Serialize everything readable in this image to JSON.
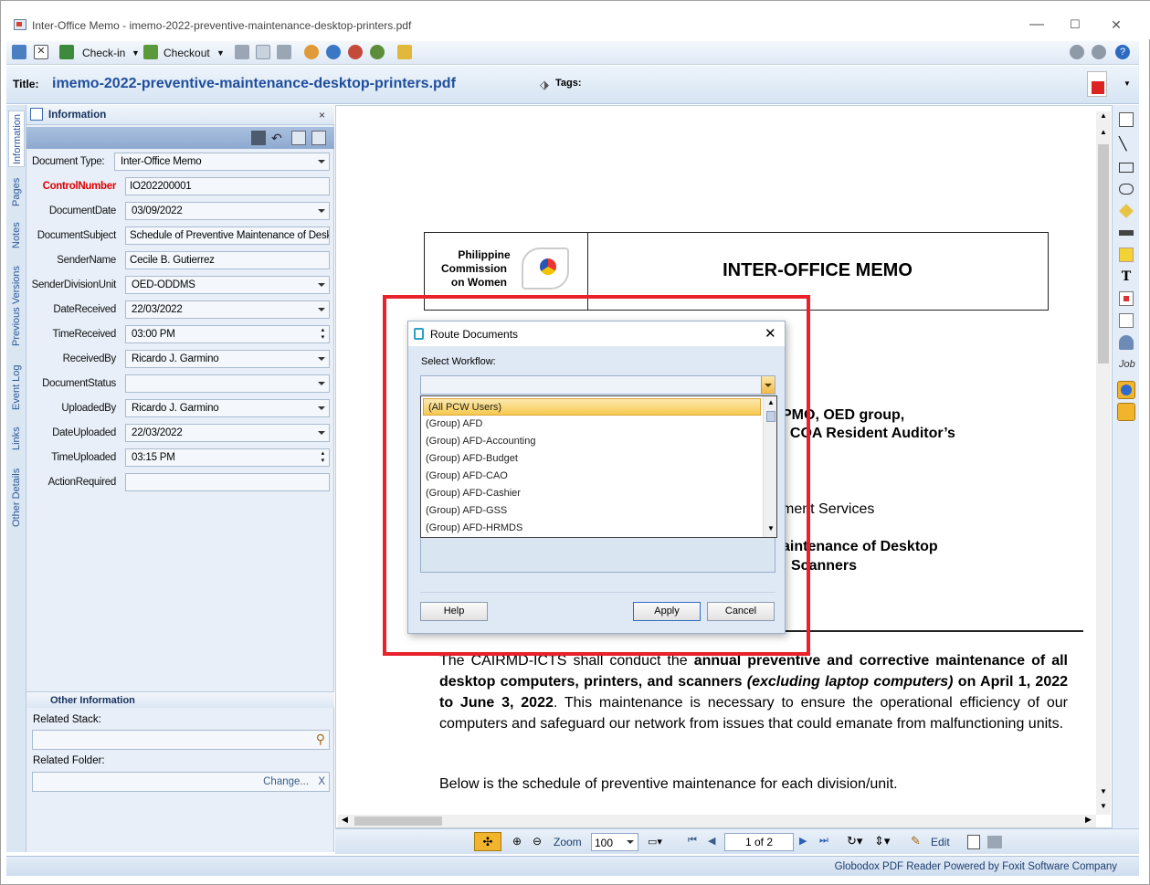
{
  "window": {
    "title": "Inter-Office Memo - imemo-2022-preventive-maintenance-desktop-printers.pdf",
    "min": "—",
    "max": "☐",
    "close": "✕"
  },
  "toolbar": {
    "checkin": "Check-in",
    "checkout": "Checkout"
  },
  "titlerow": {
    "title_label": "Title:",
    "title_value": "imemo-2022-preventive-maintenance-desktop-printers.pdf",
    "tags_label": "Tags:"
  },
  "vtabs": [
    "Information",
    "Pages",
    "Notes",
    "Previous Versions",
    "Event Log",
    "Links",
    "Other Details"
  ],
  "info": {
    "header": "Information",
    "fields": [
      {
        "label": "Document Type:",
        "value": "Inter-Office Memo",
        "dd": true
      },
      {
        "label": "ControlNumber",
        "value": "IO202200001",
        "dd": false,
        "required": true
      },
      {
        "label": "DocumentDate",
        "value": "03/09/2022",
        "dd": true
      },
      {
        "label": "DocumentSubject",
        "value": "Schedule of Preventive Maintenance of Deskto",
        "dd": false
      },
      {
        "label": "SenderName",
        "value": "Cecile B. Gutierrez",
        "dd": false
      },
      {
        "label": "SenderDivisionUnit",
        "value": "OED-ODDMS",
        "dd": true
      },
      {
        "label": "DateReceived",
        "value": "22/03/2022",
        "dd": true
      },
      {
        "label": "TimeReceived",
        "value": "03:00 PM",
        "spin": true
      },
      {
        "label": "ReceivedBy",
        "value": "Ricardo J. Garmino",
        "dd": true
      },
      {
        "label": "DocumentStatus",
        "value": "",
        "dd": true
      },
      {
        "label": "UploadedBy",
        "value": "Ricardo J. Garmino",
        "dd": true
      },
      {
        "label": "DateUploaded",
        "value": "22/03/2022",
        "dd": true
      },
      {
        "label": "TimeUploaded",
        "value": "03:15 PM",
        "spin": true
      },
      {
        "label": "ActionRequired",
        "value": "",
        "dd": false
      }
    ],
    "other_header": "Other Information",
    "related_stack": "Related Stack:",
    "related_folder": "Related Folder:",
    "change": "Change...",
    "x": "X"
  },
  "doc": {
    "org_line1": "Philippine",
    "org_line2": "Commission",
    "org_line3": "on Women",
    "memo_title": "INTER-OFFICE MEMO",
    "frag1": "PMO, OED group,",
    "frag2": "l COA Resident Auditor’s",
    "frag3": "ment Services",
    "frag4": "aintenance of Desktop",
    "frag5": "Scanners",
    "para_top": "The CAIRMD-ICTS shall conduct the",
    "para_top_bold": "annual preventive and corrective maintenance of",
    "para_l2_bold": "all desktop computers, printers, and scanners",
    "para_l2_it": "(excluding laptop computers)",
    "para_l2_b2": "on April",
    "para_l3_bold": "1, 2022 to June 3, 2022",
    "para_l3": ". This maintenance is necessary to ensure the operational efficiency",
    "para_l4": "of our computers and safeguard our network from issues that could emanate from",
    "para_l5": "malfunctioning units.",
    "para2": "Below is the schedule of preventive maintenance for each division/unit."
  },
  "bottombar": {
    "zoom_label": "Zoom",
    "zoom_value": "100",
    "page": "1 of 2",
    "edit": "Edit"
  },
  "status": "Globodox PDF Reader Powered by Foxit Software Company",
  "dialog": {
    "title": "Route Documents",
    "select_label": "Select Workflow:",
    "items": [
      "(All PCW Users)",
      "(Group) AFD",
      "(Group) AFD-Accounting",
      "(Group) AFD-Budget",
      "(Group) AFD-CAO",
      "(Group) AFD-Cashier",
      "(Group) AFD-GSS",
      "(Group) AFD-HRMDS"
    ],
    "help": "Help",
    "apply": "Apply",
    "cancel": "Cancel"
  },
  "colors": {
    "highlight": "#e8212b",
    "title_blue": "#1f4e9c",
    "required_red": "#e00000"
  }
}
